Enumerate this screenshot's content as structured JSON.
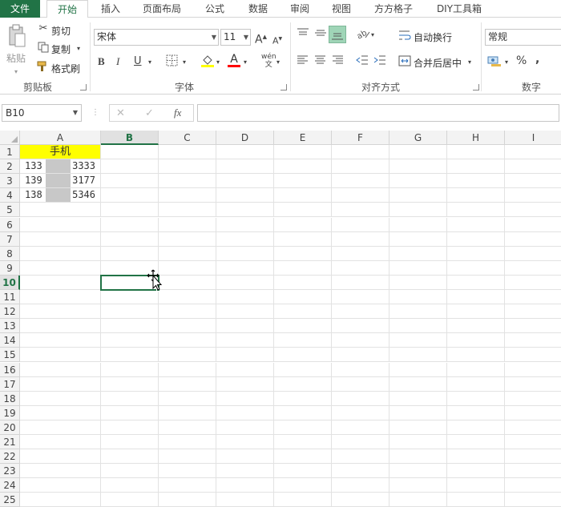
{
  "tabs": [
    "文件",
    "开始",
    "插入",
    "页面布局",
    "公式",
    "数据",
    "审阅",
    "视图",
    "方方格子",
    "DIY工具箱"
  ],
  "clipboard": {
    "paste": "粘贴",
    "cut": "剪切",
    "copy": "复制",
    "format_painter": "格式刷",
    "label": "剪贴板"
  },
  "font": {
    "name": "宋体",
    "size": "11",
    "label": "字体",
    "bold": "B",
    "italic": "I",
    "underline": "U",
    "grow": "A",
    "shrink": "A",
    "font_color": "A",
    "phonetic": "wén"
  },
  "alignment": {
    "wrap_text": "自动换行",
    "merge_center": "合并后居中",
    "label": "对齐方式"
  },
  "number": {
    "format": "常规",
    "label": "数字",
    "percent": "%",
    "comma": ","
  },
  "formula_bar": {
    "name_box": "B10",
    "cancel": "✕",
    "enter": "✓",
    "fx": "fx",
    "value": ""
  },
  "columns": [
    "A",
    "B",
    "C",
    "D",
    "E",
    "F",
    "G",
    "H",
    "I"
  ],
  "rows": [
    "1",
    "2",
    "3",
    "4",
    "5",
    "6",
    "7",
    "8",
    "9",
    "10",
    "11",
    "12",
    "13",
    "14",
    "15",
    "16",
    "17",
    "18",
    "19",
    "20",
    "21",
    "22",
    "23",
    "24",
    "25"
  ],
  "cells": {
    "A1": "手机",
    "A2": {
      "prefix": "133",
      "suffix": "3333"
    },
    "A3": {
      "prefix": "139",
      "suffix": "3177"
    },
    "A4": {
      "prefix": "138",
      "suffix": "5346"
    }
  },
  "selected": {
    "column": "B",
    "row": "10"
  },
  "colors": {
    "accent": "#217346",
    "header_fill": "#ffff00",
    "mask": "#c8c8c8"
  }
}
